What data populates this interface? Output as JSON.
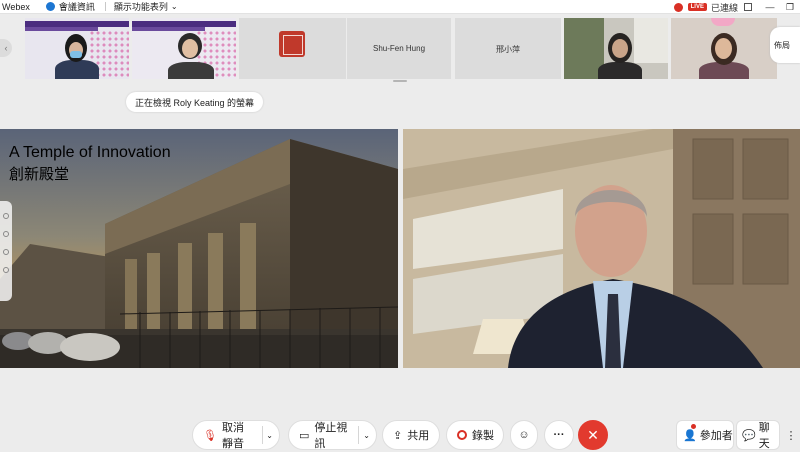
{
  "titlebar": {
    "app_name": "Webex",
    "meeting_info": "會議資訊",
    "view_menu": "顯示功能表列",
    "live_badge": "LIVE",
    "connected": "已連線"
  },
  "strip": {
    "participants": [
      {
        "name": ""
      },
      {
        "name": ""
      },
      {
        "name": ""
      },
      {
        "name": "Shu-Fen Hung"
      },
      {
        "name": "邢小萍"
      },
      {
        "name": ""
      },
      {
        "name": ""
      }
    ],
    "more_label": "佈局"
  },
  "viewing_pill": "正在檢視 Roly Keating 的螢幕",
  "shared_screen": {
    "title_en": "A Temple of Innovation",
    "title_zh": "創新殿堂"
  },
  "controls": {
    "mute": "取消靜音",
    "stop_video": "停止視訊",
    "share": "共用",
    "record": "錄製",
    "participants": "參加者",
    "chat": "聊天"
  },
  "colors": {
    "end_button": "#e23a2e",
    "record_red": "#d93025",
    "webex_blue": "#1d76d2"
  }
}
